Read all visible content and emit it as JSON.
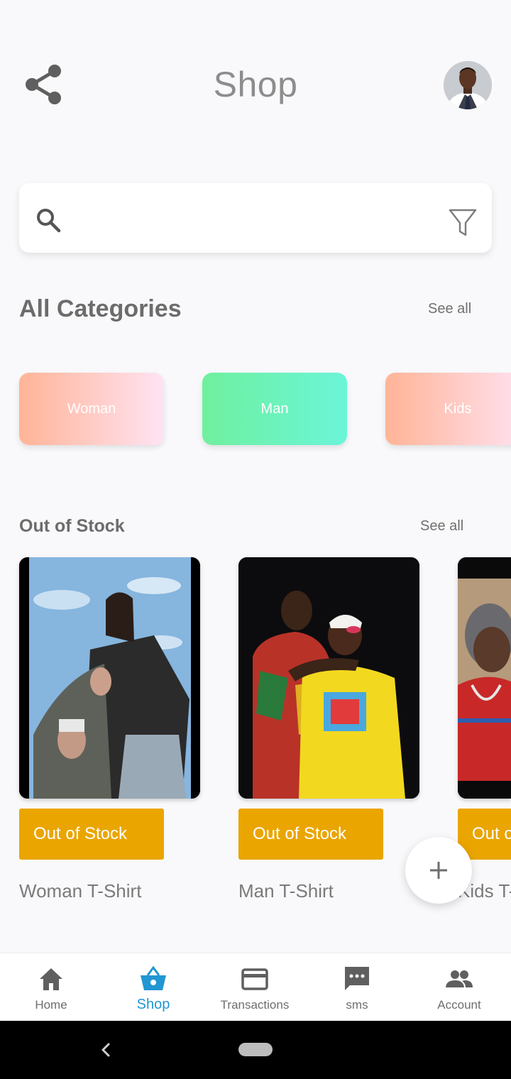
{
  "header": {
    "title": "Shop"
  },
  "search": {
    "placeholder": ""
  },
  "categories": {
    "title": "All Categories",
    "see_all": "See all",
    "items": [
      {
        "label": "Woman"
      },
      {
        "label": "Man"
      },
      {
        "label": "Kids"
      }
    ]
  },
  "out_of_stock": {
    "title": "Out of Stock",
    "see_all": "See all",
    "products": [
      {
        "badge": "Out of Stock",
        "name": "Woman T-Shirt"
      },
      {
        "badge": "Out of Stock",
        "name": "Man T-Shirt"
      },
      {
        "badge": "Out of Stock",
        "name": "Kids T-Shirt"
      }
    ]
  },
  "bottom_nav": {
    "items": [
      {
        "label": "Home",
        "icon": "home-icon"
      },
      {
        "label": "Shop",
        "icon": "basket-icon",
        "active": true
      },
      {
        "label": "Transactions",
        "icon": "credit-card-icon"
      },
      {
        "label": "sms",
        "icon": "chat-icon"
      },
      {
        "label": "Account",
        "icon": "people-icon"
      }
    ]
  },
  "colors": {
    "accent": "#2196d3",
    "stock_badge": "#eaa500",
    "title_gray": "#8d8d8d"
  }
}
